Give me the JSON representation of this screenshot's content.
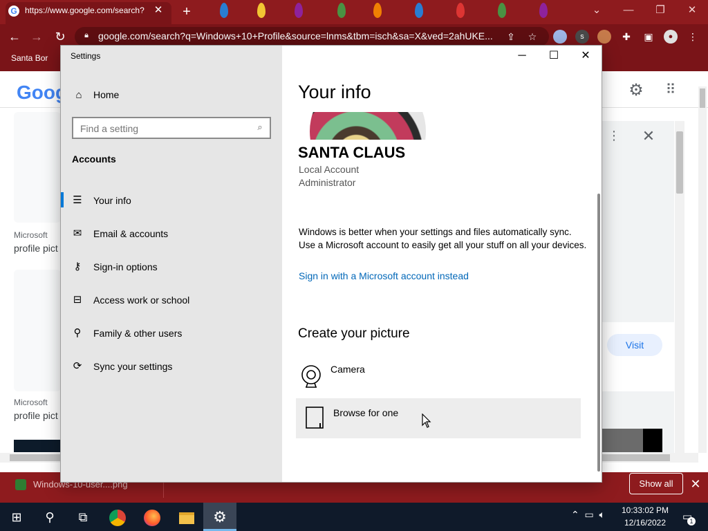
{
  "browser": {
    "tab_title": "https://www.google.com/search?",
    "tab_favicon": "G",
    "url": "google.com/search?q=Windows+10+Profile&source=lnms&tbm=isch&sa=X&ved=2ahUKE...",
    "bookmark": "Santa Bor",
    "ext_s": "s",
    "icons": [
      "back-icon",
      "forward-icon",
      "reload-icon",
      "lock-icon",
      "share-icon",
      "star-icon",
      "extensions-icon",
      "sidepanel-icon",
      "profile-icon",
      "menu-icon"
    ],
    "theme_color": "#8e1b1e"
  },
  "google": {
    "logo": "Goog",
    "results": [
      {
        "source": "Microsoft",
        "title": "profile pict"
      },
      {
        "source": "Microsoft",
        "title": "profile pict"
      }
    ],
    "visit_label": "Visit"
  },
  "download": {
    "filename": "Windows-10-user....png",
    "show_all": "Show all"
  },
  "settings": {
    "window_title": "Settings",
    "nav": {
      "home": "Home",
      "search_placeholder": "Find a setting",
      "section": "Accounts",
      "items": [
        {
          "label": "Your info",
          "icon": "person-list-icon"
        },
        {
          "label": "Email & accounts",
          "icon": "mail-icon"
        },
        {
          "label": "Sign-in options",
          "icon": "key-icon"
        },
        {
          "label": "Access work or school",
          "icon": "briefcase-icon"
        },
        {
          "label": "Family & other users",
          "icon": "person-add-icon"
        },
        {
          "label": "Sync your settings",
          "icon": "sync-icon"
        }
      ],
      "active_index": 0
    },
    "main": {
      "heading": "Your info",
      "user_name": "SANTA CLAUS",
      "account_type": "Local Account",
      "account_role": "Administrator",
      "sync_text": "Windows is better when your settings and files automatically sync. Use a Microsoft account to easily get all your stuff on all your devices.",
      "ms_link": "Sign in with a Microsoft account instead",
      "create_heading": "Create your picture",
      "camera_label": "Camera",
      "browse_label": "Browse for one"
    },
    "accent_color": "#0078d7",
    "link_color": "#0067b8"
  },
  "taskbar": {
    "time": "10:33:02 PM",
    "date": "12/16/2022",
    "notification_count": "1",
    "icons": [
      "windows-start-icon",
      "search-icon",
      "task-view-icon",
      "chrome-icon",
      "firefox-icon",
      "file-explorer-icon",
      "settings-gear-icon"
    ]
  }
}
